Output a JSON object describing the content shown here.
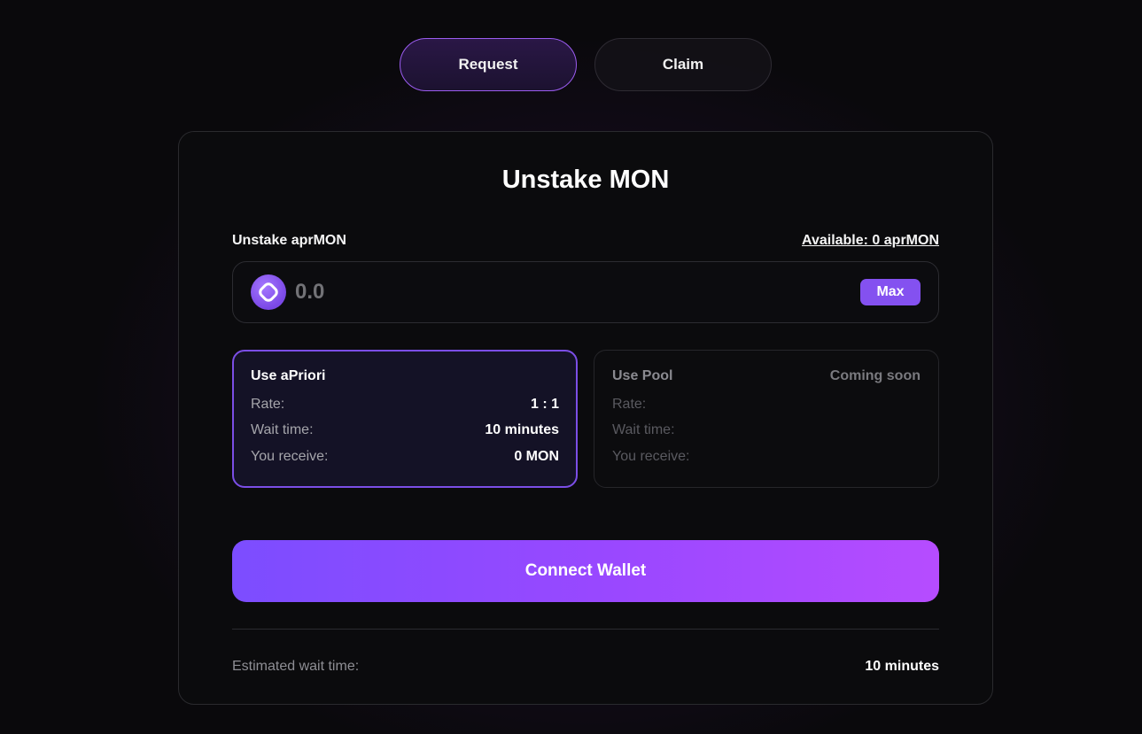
{
  "tabs": [
    {
      "label": "Request",
      "active": true
    },
    {
      "label": "Claim",
      "active": false
    }
  ],
  "card": {
    "title": "Unstake MON",
    "input_label": "Unstake aprMON",
    "available": "Available: 0 aprMON",
    "amount_placeholder": "0.0",
    "token_icon": "apriori-token-icon",
    "max_label": "Max"
  },
  "options": {
    "apriori": {
      "title": "Use aPriori",
      "rate_label": "Rate:",
      "rate_value": "1 : 1",
      "wait_label": "Wait time:",
      "wait_value": "10 minutes",
      "receive_label": "You receive:",
      "receive_value": "0 MON"
    },
    "pool": {
      "title": "Use Pool",
      "status": "Coming soon",
      "rate_label": "Rate:",
      "wait_label": "Wait time:",
      "receive_label": "You receive:"
    }
  },
  "connect_label": "Connect Wallet",
  "estimate": {
    "label": "Estimated wait time:",
    "value": "10 minutes"
  },
  "colors": {
    "accent": "#8451f0",
    "button_gradient_start": "#7c4dff",
    "button_gradient_end": "#b64cff",
    "background": "#0a090c"
  }
}
